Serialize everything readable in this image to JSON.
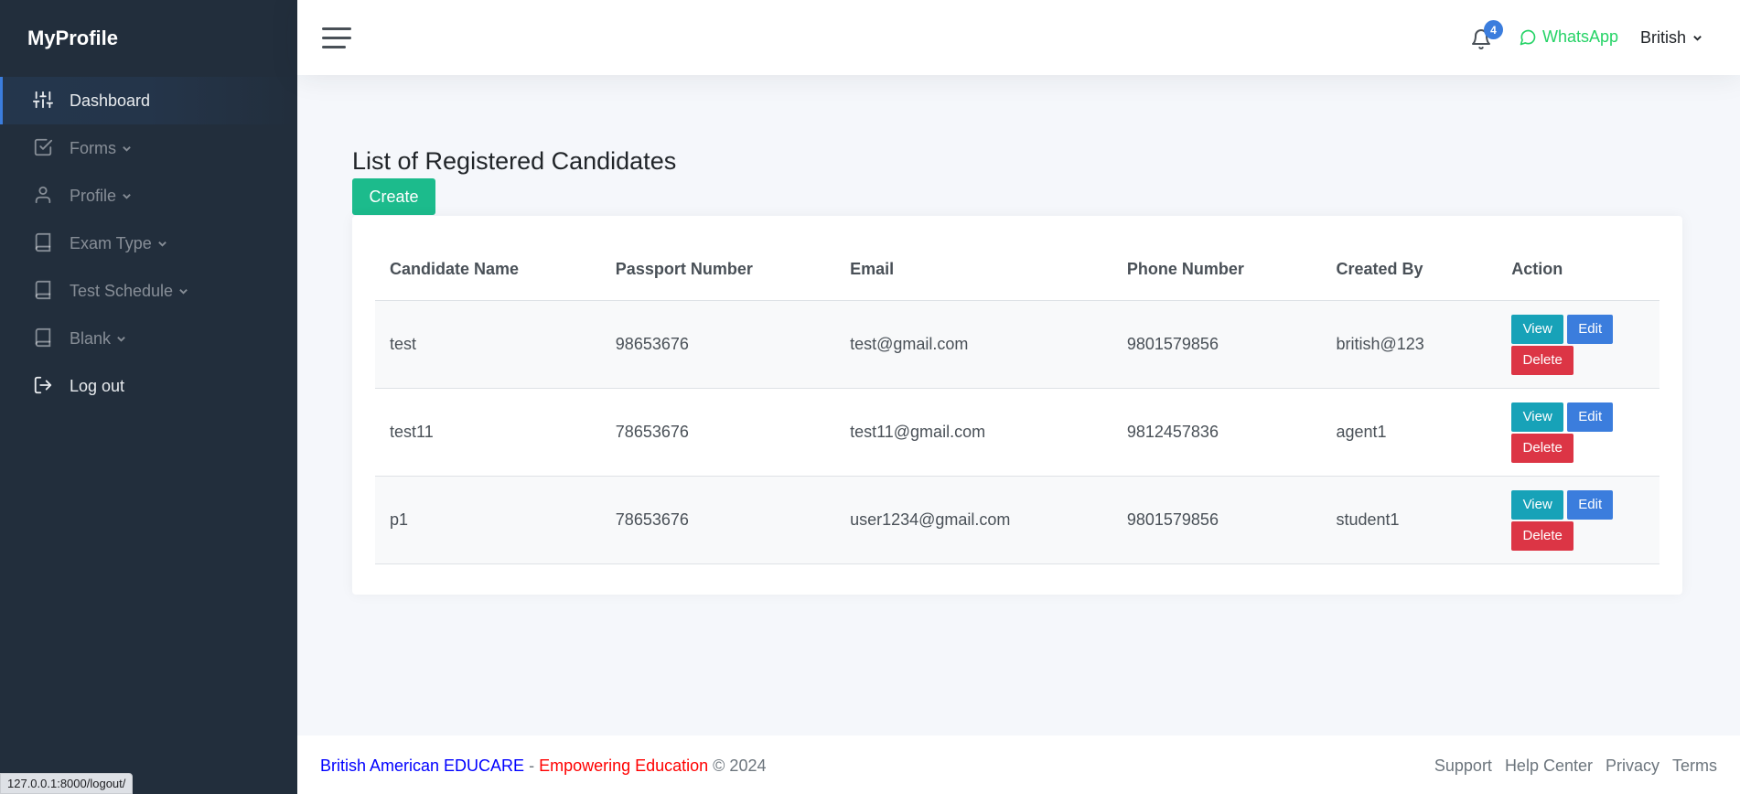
{
  "sidebar": {
    "brand": "MyProfile",
    "items": [
      {
        "label": "Dashboard",
        "icon": "sliders-icon",
        "active": true
      },
      {
        "label": "Forms",
        "icon": "check-square-icon",
        "dropdown": true
      },
      {
        "label": "Profile",
        "icon": "user-icon",
        "dropdown": true
      },
      {
        "label": "Exam Type",
        "icon": "book-icon",
        "dropdown": true
      },
      {
        "label": "Test Schedule",
        "icon": "book-icon",
        "dropdown": true
      },
      {
        "label": "Blank",
        "icon": "book-icon",
        "dropdown": true
      },
      {
        "label": "Log out",
        "icon": "log-out-icon"
      }
    ]
  },
  "topbar": {
    "notification_count": "4",
    "whatsapp_label": "WhatsApp",
    "language_label": "British"
  },
  "main": {
    "title": "List of Registered Candidates",
    "create_label": "Create",
    "table": {
      "headers": [
        "Candidate Name",
        "Passport Number",
        "Email",
        "Phone Number",
        "Created By",
        "Action"
      ],
      "rows": [
        {
          "name": "test",
          "passport": "98653676",
          "email": "test@gmail.com",
          "phone": "9801579856",
          "created_by": "british@123"
        },
        {
          "name": "test11",
          "passport": "78653676",
          "email": "test11@gmail.com",
          "phone": "9812457836",
          "created_by": "agent1"
        },
        {
          "name": "p1",
          "passport": "78653676",
          "email": "user1234@gmail.com",
          "phone": "9801579856",
          "created_by": "student1"
        }
      ],
      "view_label": "View",
      "edit_label": "Edit",
      "delete_label": "Delete"
    }
  },
  "footer": {
    "brand": "British American EDUCARE",
    "separator": " - ",
    "tagline": "Empowering Education",
    "copyright": " © 2024",
    "links": [
      "Support",
      "Help Center",
      "Privacy",
      "Terms"
    ]
  },
  "statusbar": {
    "url": "127.0.0.1:8000/logout/"
  },
  "colors": {
    "sidebar_bg": "#222e3c",
    "primary": "#3b7ddd",
    "success": "#1cbb8c",
    "info": "#17a2b8",
    "danger": "#dc3545",
    "whatsapp": "#25d366"
  }
}
